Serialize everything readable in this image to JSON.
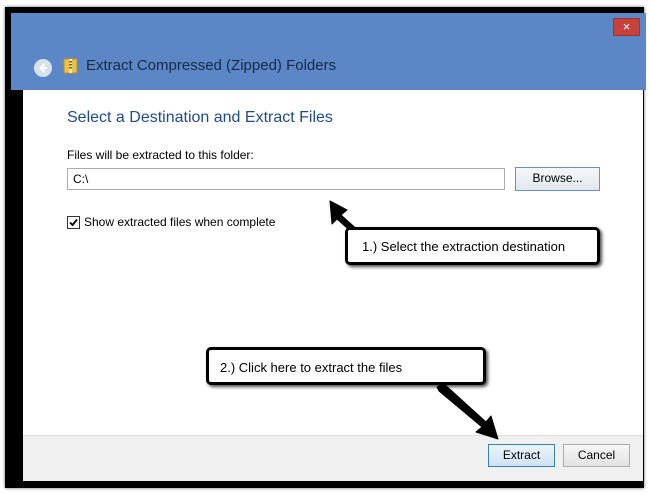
{
  "window": {
    "title": "Extract Compressed (Zipped) Folders",
    "close_glyph": "×"
  },
  "main": {
    "heading": "Select a Destination and Extract Files",
    "path_label": "Files will be extracted to this folder:",
    "path_value": "C:\\",
    "browse_label": "Browse...",
    "show_files_label": "Show extracted files when complete",
    "show_files_checked": true
  },
  "footer": {
    "extract_label": "Extract",
    "cancel_label": "Cancel"
  },
  "annotations": {
    "callout_1": "1.) Select the extraction destination",
    "callout_2": "2.) Click here to extract the files"
  },
  "colors": {
    "titlebar": "#5b87c7",
    "heading": "#1f4b91",
    "close_button": "#c7423a"
  },
  "icons": {
    "back": "back-arrow-icon",
    "folder": "zip-folder-icon",
    "close": "close-icon",
    "check": "checkmark-icon"
  }
}
